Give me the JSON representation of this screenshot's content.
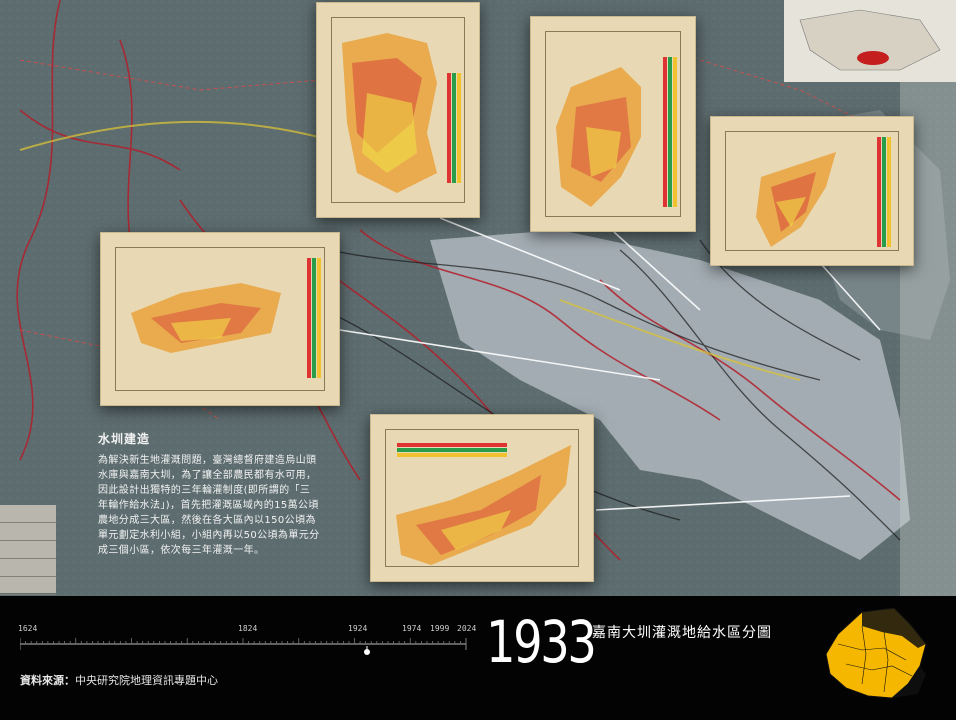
{
  "info": {
    "heading": "水圳建造",
    "body": "為解決新生地灌溉問題，臺灣總督府建造烏山頭水庫與嘉南大圳，為了讓全部農民都有水可用，因此設計出獨特的三年輪灌制度(即所謂的「三年輪作給水法」)，首先把灌溉區域內的15萬公頃農地分成三大區，然後在各大區內以150公頃為單元劃定水利小組，小組內再以50公頃為單元分成三個小區，依次每三年灌溉一年。"
  },
  "timeline": {
    "labels": [
      "1624",
      "1824",
      "1924",
      "1974",
      "1999",
      "2024"
    ],
    "current_year": "1933"
  },
  "title": "嘉南大圳灌溉地給水區分圖",
  "source": {
    "label": "資料來源：",
    "value": "中央研究院地理資訊專題中心"
  },
  "colors": {
    "map_bg": "#5b6b6e",
    "paper": "#e8d9b4",
    "accent_yellow": "#f5b700",
    "callout_line": "#ffffff"
  }
}
